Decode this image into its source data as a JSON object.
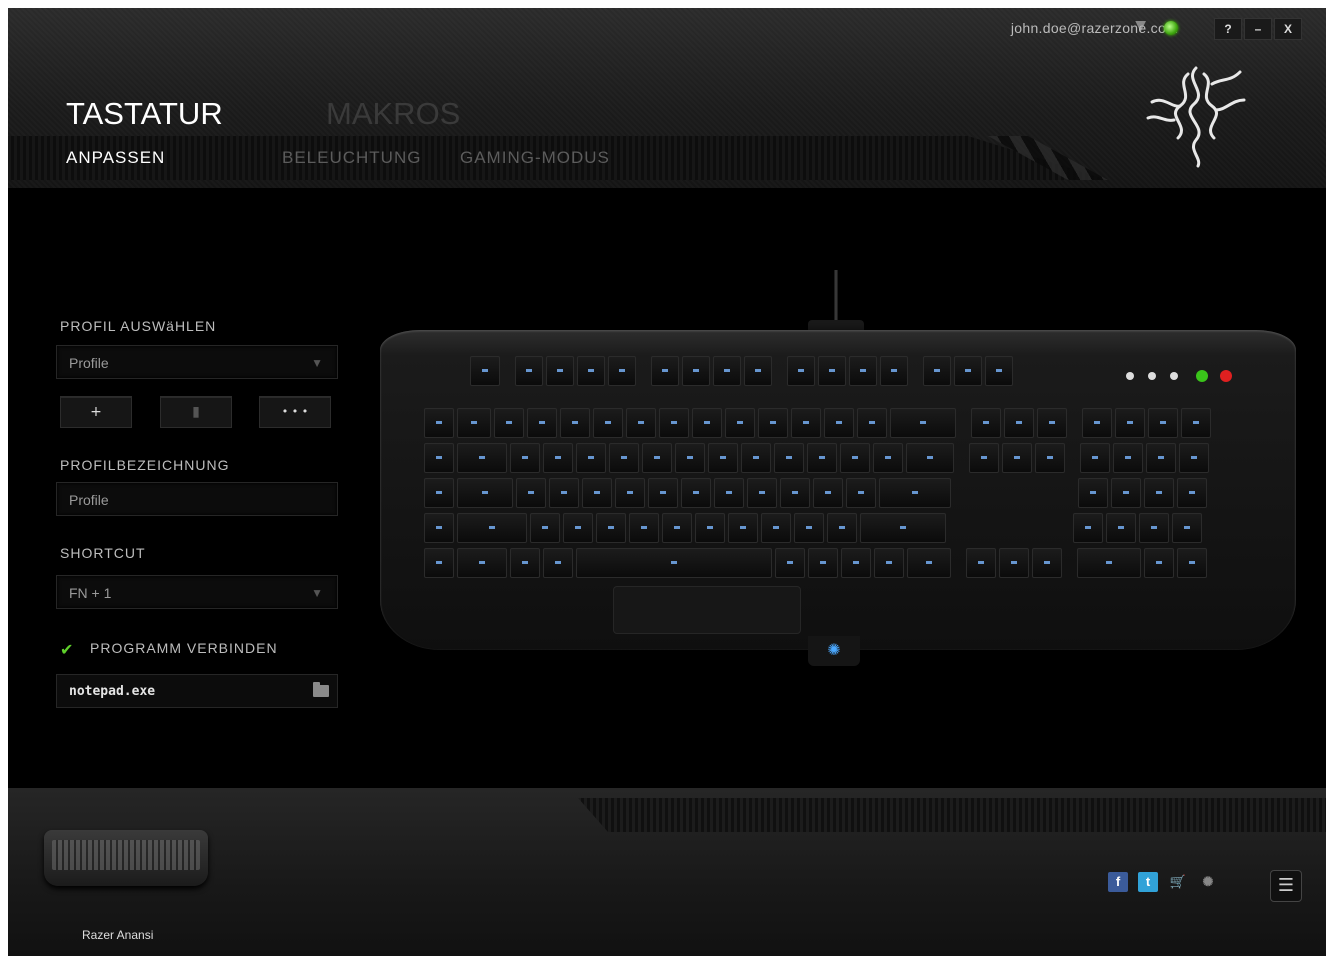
{
  "header": {
    "account_email": "john.doe@razerzone.com",
    "window_buttons": [
      "?",
      "–",
      "X"
    ],
    "main_tabs": [
      "TASTATUR",
      "MAKROS"
    ],
    "sub_tabs": [
      "ANPASSEN",
      "BELEUCHTUNG",
      "GAMING-MODUS"
    ]
  },
  "left_panel": {
    "profile_select_label": "PROFIL AUSWäHLEN",
    "profile_select_value": "Profile",
    "profile_buttons": [
      "+",
      "",
      "• • •"
    ],
    "profile_name_label": "PROFILBEZEICHNUNG",
    "profile_name_value": "Profile",
    "shortcut_label": "SHORTCUT",
    "shortcut_value": "FN + 1",
    "link_program_label": "PROGRAMM VERBINDEN",
    "link_program_checked": true,
    "program_file": "notepad.exe"
  },
  "footer": {
    "device_name": "Razer Anansi"
  },
  "colors": {
    "accent_green": "#5fd02b",
    "key_backlight": "#7cb7ff",
    "facebook": "#3b5b9a",
    "twitter": "#31a2d8"
  },
  "icons": [
    "status-dot-icon",
    "razer-logo-icon",
    "dropdown-arrow-icon",
    "check-icon",
    "folder-icon",
    "facebook-icon",
    "twitter-icon",
    "cart-icon",
    "razer-small-icon",
    "menu-icon"
  ]
}
